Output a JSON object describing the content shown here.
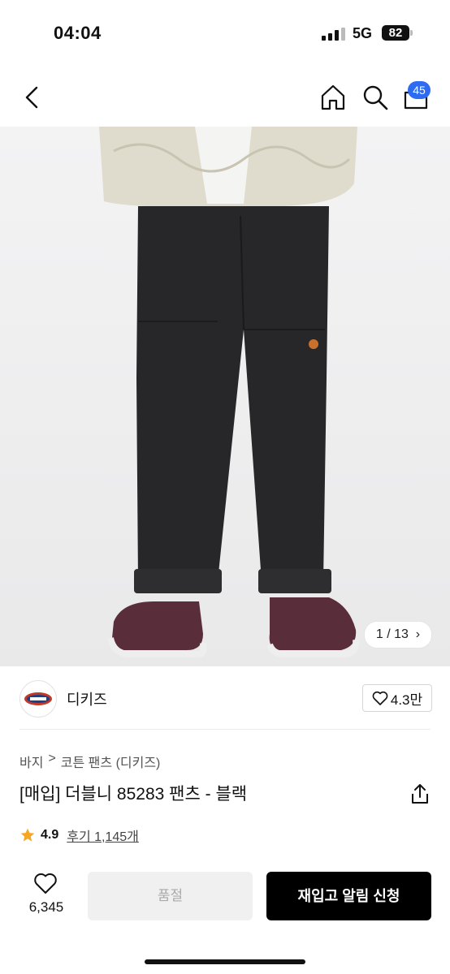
{
  "status_bar": {
    "time": "04:04",
    "network": "5G",
    "battery": "82"
  },
  "header": {
    "cart_count": "45"
  },
  "gallery": {
    "counter": "1 / 13"
  },
  "brand": {
    "name": "디키즈",
    "likes": "4.3만"
  },
  "breadcrumb": {
    "category": "바지",
    "separator": ">",
    "sub_category": "코튼 팬츠 (디키즈)"
  },
  "product": {
    "title": "[매입] 더블니 85283 팬츠 - 블랙",
    "rating": "4.9",
    "reviews": "후기 1,145개"
  },
  "bottom_bar": {
    "wish_count": "6,345",
    "soldout_label": "품절",
    "restock_label": "재입고 알림 신청"
  },
  "colors": {
    "accent": "#2d6cf0",
    "star": "#f5a623"
  }
}
